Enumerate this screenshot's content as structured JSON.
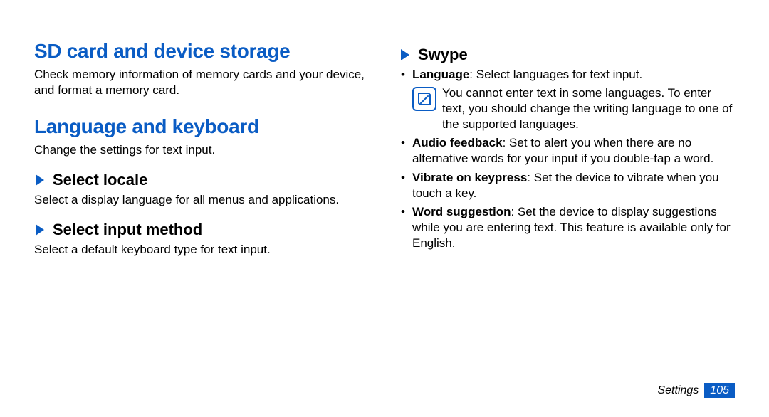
{
  "left": {
    "section1_heading": "SD card and device storage",
    "section1_body": "Check memory information of memory cards and your device, and format a memory card.",
    "section2_heading": "Language and keyboard",
    "section2_body": "Change the settings for text input.",
    "sub1_label": "Select locale",
    "sub1_body": "Select a display language for all menus and applications.",
    "sub2_label": "Select input method",
    "sub2_body": "Select a default keyboard type for text input."
  },
  "right": {
    "sub_label": "Swype",
    "b1_label": "Language",
    "b1_text": ": Select languages for text input.",
    "note_text": "You cannot enter text in some languages. To enter text, you should change the writing language to one of the supported languages.",
    "b2_label": "Audio feedback",
    "b2_text": ": Set to alert you when there are no alternative words for your input if you double-tap a word.",
    "b3_label": "Vibrate on keypress",
    "b3_text": ": Set the device to vibrate when you touch a key.",
    "b4_label": "Word suggestion",
    "b4_text": ": Set the device to display suggestions while you are entering text. This feature is available only for English."
  },
  "footer": {
    "label": "Settings",
    "page": "105"
  }
}
